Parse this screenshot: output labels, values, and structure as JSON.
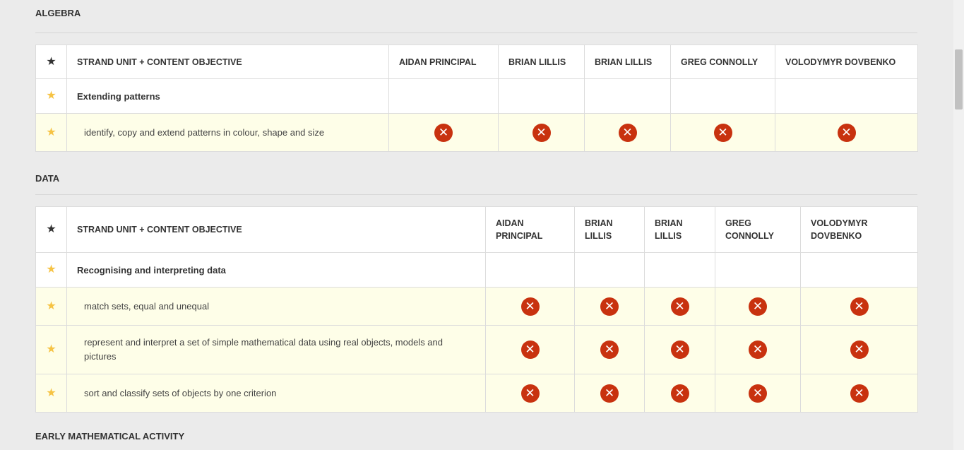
{
  "icons": {
    "star": "star-icon",
    "cross": "cross-circle-icon"
  },
  "colors": {
    "cross": "#c8320f",
    "star_gold": "#f6c344",
    "row_highlight": "#fefee8"
  },
  "sections": [
    {
      "title": "ALGEBRA",
      "header": {
        "objective": "STRAND UNIT + CONTENT OBJECTIVE",
        "people": [
          "AIDAN PRINCIPAL",
          "BRIAN LILLIS",
          "BRIAN LILLIS",
          "GREG CONNOLLY",
          "VOLODYMYR DOVBENKO"
        ]
      },
      "strand": "Extending patterns",
      "objectives": [
        "identify, copy and extend patterns in colour, shape and size"
      ]
    },
    {
      "title": "DATA",
      "header": {
        "objective": "STRAND UNIT + CONTENT OBJECTIVE",
        "people": [
          "AIDAN PRINCIPAL",
          "BRIAN LILLIS",
          "BRIAN LILLIS",
          "GREG CONNOLLY",
          "VOLODYMYR DOVBENKO"
        ]
      },
      "strand": "Recognising and interpreting data",
      "objectives": [
        "match sets, equal and unequal",
        "represent and interpret a set of simple mathematical data using real objects, models and pictures",
        "sort and classify sets of objects by one criterion"
      ]
    },
    {
      "title": "EARLY MATHEMATICAL ACTIVITY"
    }
  ]
}
